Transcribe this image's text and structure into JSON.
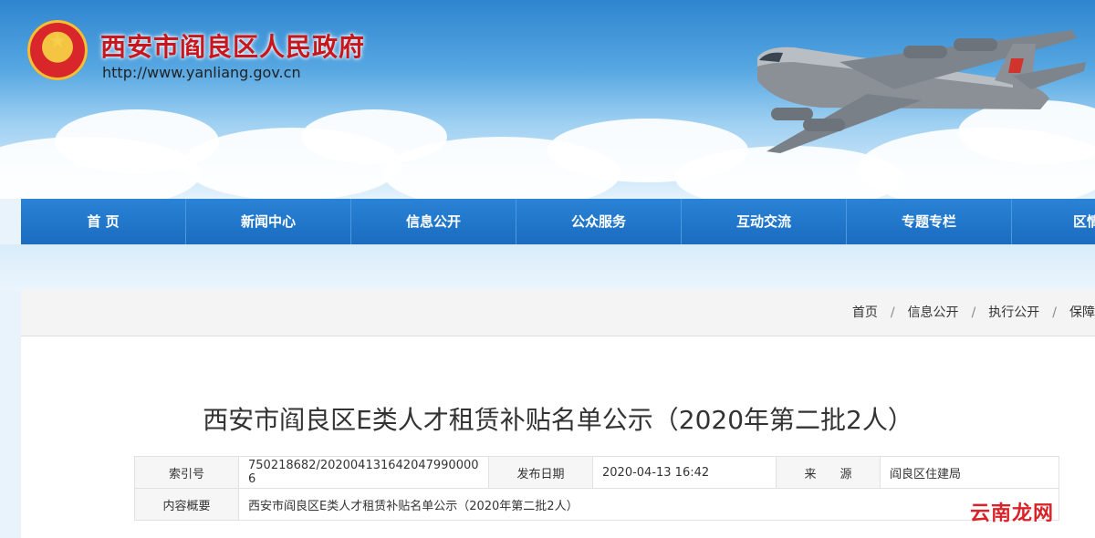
{
  "header": {
    "site_title": "西安市阎良区人民政府",
    "site_url": "http://www.yanliang.gov.cn"
  },
  "nav": {
    "items": [
      "首  页",
      "新闻中心",
      "信息公开",
      "公众服务",
      "互动交流",
      "专题专栏",
      "区情概"
    ]
  },
  "breadcrumb": {
    "items": [
      "首页",
      "信息公开",
      "执行公开",
      "保障"
    ],
    "separator": "/"
  },
  "article": {
    "title": "西安市阎良区E类人才租赁补贴名单公示（2020年第二批2人）",
    "meta": {
      "index_label": "索引号",
      "index_value": "750218682/202004131642047990000 6",
      "date_label": "发布日期",
      "date_value": "2020-04-13 16:42",
      "source_label": "来　　源",
      "source_value": "阎良区住建局",
      "summary_label": "内容概要",
      "summary_value": "西安市阎良区E类人才租赁补贴名单公示（2020年第二批2人）"
    }
  },
  "watermark": "云南龙网",
  "colors": {
    "brand_red": "#c8161d",
    "nav_blue": "#1a6cc0"
  }
}
